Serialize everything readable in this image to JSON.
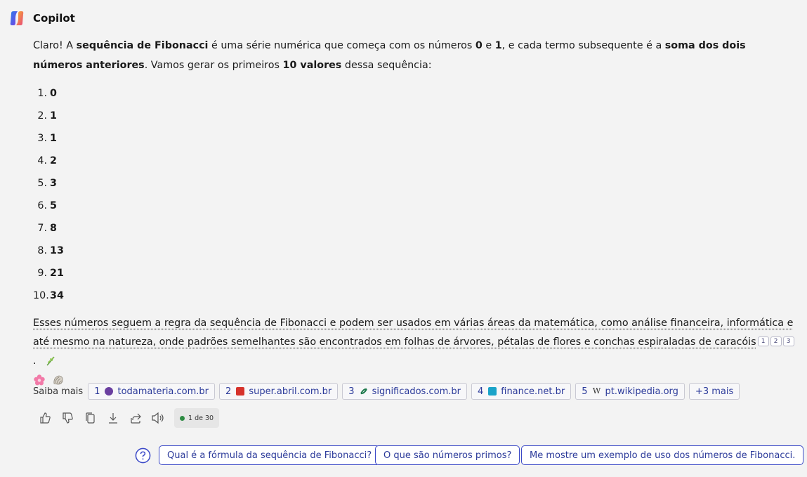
{
  "header": {
    "brand": "Copilot",
    "logo_icon": "copilot-logo-icon"
  },
  "intro": {
    "p1": "Claro! A ",
    "b1": "sequência de Fibonacci",
    "p2": " é uma série numérica que começa com os números ",
    "b2": "0",
    "p3": " e ",
    "b3": "1",
    "p4": ", e cada termo subsequente é a ",
    "b4": "soma dos dois números anteriores",
    "p5": ". Vamos gerar os primeiros ",
    "b5": "10 valores",
    "p6": " dessa sequência:"
  },
  "list": [
    {
      "n": "1.",
      "v": "0"
    },
    {
      "n": "2.",
      "v": "1"
    },
    {
      "n": "3.",
      "v": "1"
    },
    {
      "n": "4.",
      "v": "2"
    },
    {
      "n": "5.",
      "v": "3"
    },
    {
      "n": "6.",
      "v": "5"
    },
    {
      "n": "7.",
      "v": "8"
    },
    {
      "n": "8.",
      "v": "13"
    },
    {
      "n": "9.",
      "v": "21"
    },
    {
      "n": "10.",
      "v": "34"
    }
  ],
  "summary": {
    "text": "Esses números seguem a regra da sequência de Fibonacci e podem ser usados em várias áreas da matemática, como análise financeira, informática e até mesmo na natureza, onde padrões semelhantes são encontrados em folhas de árvores, pétalas de flores e conchas espiraladas de caracóis",
    "citations": [
      "1",
      "2",
      "3"
    ],
    "end": ".",
    "emojis": [
      "herb-emoji",
      "flower-emoji",
      "shell-emoji"
    ]
  },
  "sources": {
    "label": "Saiba mais",
    "items": [
      {
        "num": "1",
        "label": "todamateria.com.br",
        "color": "#6a3fa0"
      },
      {
        "num": "2",
        "label": "super.abril.com.br",
        "color": "#d6322b"
      },
      {
        "num": "3",
        "label": "significados.com.br",
        "color": "#1f7a4d"
      },
      {
        "num": "4",
        "label": "finance.net.br",
        "color": "#1aa3c9"
      },
      {
        "num": "5",
        "label": "pt.wikipedia.org",
        "color": "#333333"
      }
    ],
    "more": "+3 mais"
  },
  "toolbar": {
    "icons": [
      "thumbs-up-icon",
      "thumbs-down-icon",
      "copy-icon",
      "download-icon",
      "share-icon",
      "speaker-icon"
    ],
    "counter": "1 de 30",
    "counter_color": "#2e8b43"
  },
  "suggestions": {
    "icon": "question-icon",
    "items": [
      "Qual é a fórmula da sequência de Fibonacci?",
      "O que são números primos?",
      "Me mostre um exemplo de uso dos números de Fibonacci."
    ]
  }
}
